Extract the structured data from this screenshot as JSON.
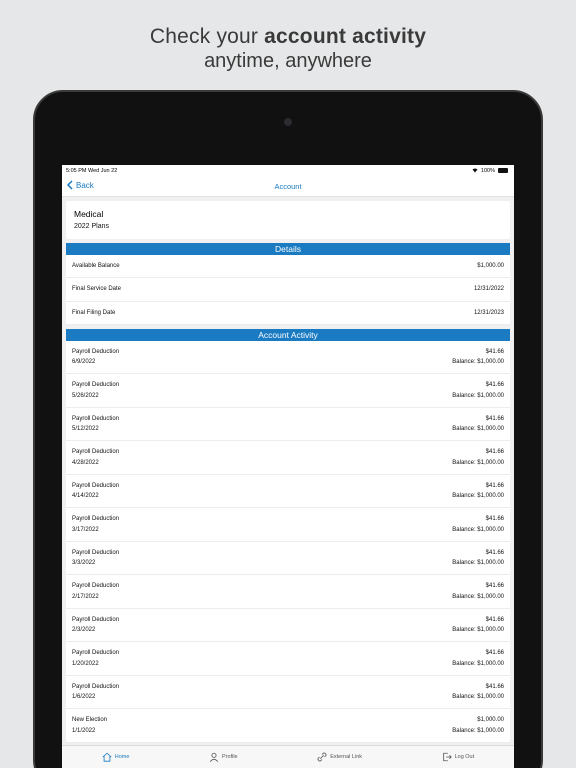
{
  "promo": {
    "line1_pre": "Check your ",
    "line1_bold": "account activity",
    "line2": "anytime, anywhere"
  },
  "status": {
    "time_date": "5:05 PM  Wed Jun 22",
    "battery": "100%"
  },
  "nav": {
    "back_label": "Back",
    "title": "Account"
  },
  "account": {
    "name": "Medical",
    "plan": "2022 Plans"
  },
  "details": {
    "header": "Details",
    "rows": [
      {
        "label": "Available Balance",
        "value": "$1,000.00"
      },
      {
        "label": "Final Service Date",
        "value": "12/31/2022"
      },
      {
        "label": "Final Filing Date",
        "value": "12/31/2023"
      }
    ]
  },
  "activity": {
    "header": "Account Activity",
    "items": [
      {
        "type": "Payroll Deduction",
        "date": "6/9/2022",
        "amount": "$41.66",
        "balance": "Balance: $1,000.00"
      },
      {
        "type": "Payroll Deduction",
        "date": "5/26/2022",
        "amount": "$41.66",
        "balance": "Balance: $1,000.00"
      },
      {
        "type": "Payroll Deduction",
        "date": "5/12/2022",
        "amount": "$41.66",
        "balance": "Balance: $1,000.00"
      },
      {
        "type": "Payroll Deduction",
        "date": "4/28/2022",
        "amount": "$41.66",
        "balance": "Balance: $1,000.00"
      },
      {
        "type": "Payroll Deduction",
        "date": "4/14/2022",
        "amount": "$41.66",
        "balance": "Balance: $1,000.00"
      },
      {
        "type": "Payroll Deduction",
        "date": "3/17/2022",
        "amount": "$41.66",
        "balance": "Balance: $1,000.00"
      },
      {
        "type": "Payroll Deduction",
        "date": "3/3/2022",
        "amount": "$41.66",
        "balance": "Balance: $1,000.00"
      },
      {
        "type": "Payroll Deduction",
        "date": "2/17/2022",
        "amount": "$41.66",
        "balance": "Balance: $1,000.00"
      },
      {
        "type": "Payroll Deduction",
        "date": "2/3/2022",
        "amount": "$41.66",
        "balance": "Balance: $1,000.00"
      },
      {
        "type": "Payroll Deduction",
        "date": "1/20/2022",
        "amount": "$41.66",
        "balance": "Balance: $1,000.00"
      },
      {
        "type": "Payroll Deduction",
        "date": "1/6/2022",
        "amount": "$41.66",
        "balance": "Balance: $1,000.00"
      },
      {
        "type": "New Election",
        "date": "1/1/2022",
        "amount": "$1,000.00",
        "balance": "Balance: $1,000.00"
      }
    ]
  },
  "tabs": [
    {
      "label": "Home",
      "icon": "home-icon",
      "active": true
    },
    {
      "label": "Profile",
      "icon": "person-icon",
      "active": false
    },
    {
      "label": "External Link",
      "icon": "link-icon",
      "active": false
    },
    {
      "label": "Log Out",
      "icon": "logout-icon",
      "active": false
    }
  ],
  "colors": {
    "accent": "#1a7ac2",
    "background": "#e6e7e8",
    "device": "#111111"
  }
}
